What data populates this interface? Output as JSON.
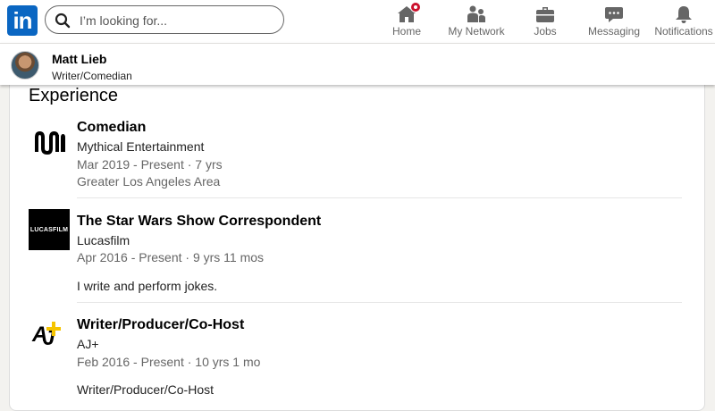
{
  "nav": {
    "logo_text": "in",
    "search_placeholder": "I’m looking for...",
    "items": [
      {
        "label": "Home",
        "icon": "home-icon"
      },
      {
        "label": "My Network",
        "icon": "network-icon"
      },
      {
        "label": "Jobs",
        "icon": "briefcase-icon"
      },
      {
        "label": "Messaging",
        "icon": "messaging-icon"
      },
      {
        "label": "Notifications",
        "icon": "bell-icon"
      }
    ]
  },
  "profile": {
    "name": "Matt Lieb",
    "headline": "Writer/Comedian"
  },
  "experience": {
    "title": "Experience",
    "items": [
      {
        "role": "Comedian",
        "company": "Mythical Entertainment",
        "dates": "Mar 2019 - Present · 7 yrs",
        "location": "Greater Los Angeles Area",
        "logo": "mythical-logo"
      },
      {
        "role": "The Star Wars Show Correspondent",
        "company": "Lucasfilm",
        "dates": "Apr 2016 - Present · 9 yrs 11 mos",
        "description": "I write and perform jokes.",
        "logo": "lucasfilm-logo",
        "logo_text": "LUCASFILM"
      },
      {
        "role": "Writer/Producer/Co-Host",
        "company": "AJ+",
        "dates": "Feb 2016 - Present · 10 yrs 1 mo",
        "description": "Writer/Producer/Co-Host",
        "logo": "ajplus-logo"
      }
    ]
  },
  "colors": {
    "brand": "#0a66c2",
    "notification": "#cb112d",
    "background": "#f3f2ef"
  }
}
